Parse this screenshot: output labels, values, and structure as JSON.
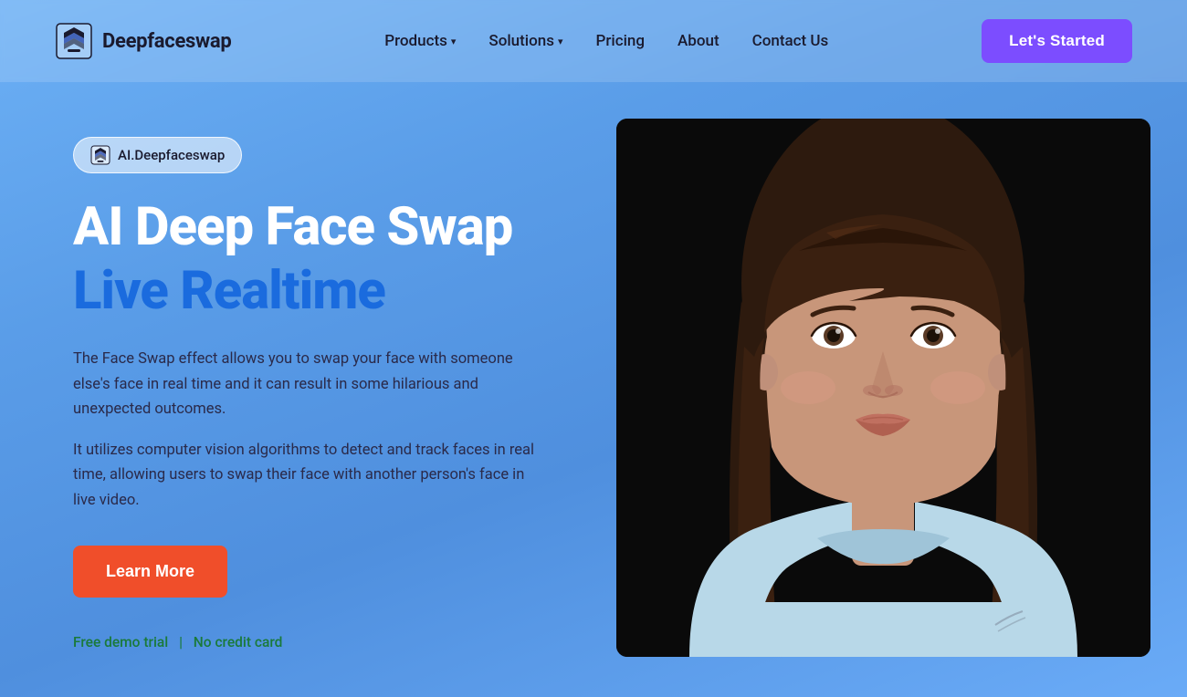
{
  "brand": {
    "name": "Deepfaceswap",
    "badge_label": "AI.Deepfaceswap"
  },
  "nav": {
    "links": [
      {
        "label": "Products",
        "has_dropdown": true
      },
      {
        "label": "Solutions",
        "has_dropdown": true
      },
      {
        "label": "Pricing",
        "has_dropdown": false
      },
      {
        "label": "About",
        "has_dropdown": false
      },
      {
        "label": "Contact Us",
        "has_dropdown": false
      }
    ],
    "cta": "Let's Started"
  },
  "hero": {
    "title_line1": "AI Deep Face Swap",
    "title_line2": "Live Realtime",
    "description1": "The Face Swap effect allows you to swap your face with someone else's face in real time and it can result in some hilarious and unexpected outcomes.",
    "description2": "It utilizes computer vision algorithms to detect and track faces in real time, allowing users to swap their face with another person's face in live video.",
    "cta_button": "Learn More",
    "free_trial": "Free demo trial",
    "no_credit": "No credit card"
  },
  "colors": {
    "bg_gradient_start": "#6cb0f5",
    "bg_gradient_end": "#5a9de8",
    "cta_purple": "#7c4dff",
    "cta_orange": "#f04e2a",
    "title_blue": "#1a6bde",
    "green_text": "#1a7a3a"
  }
}
